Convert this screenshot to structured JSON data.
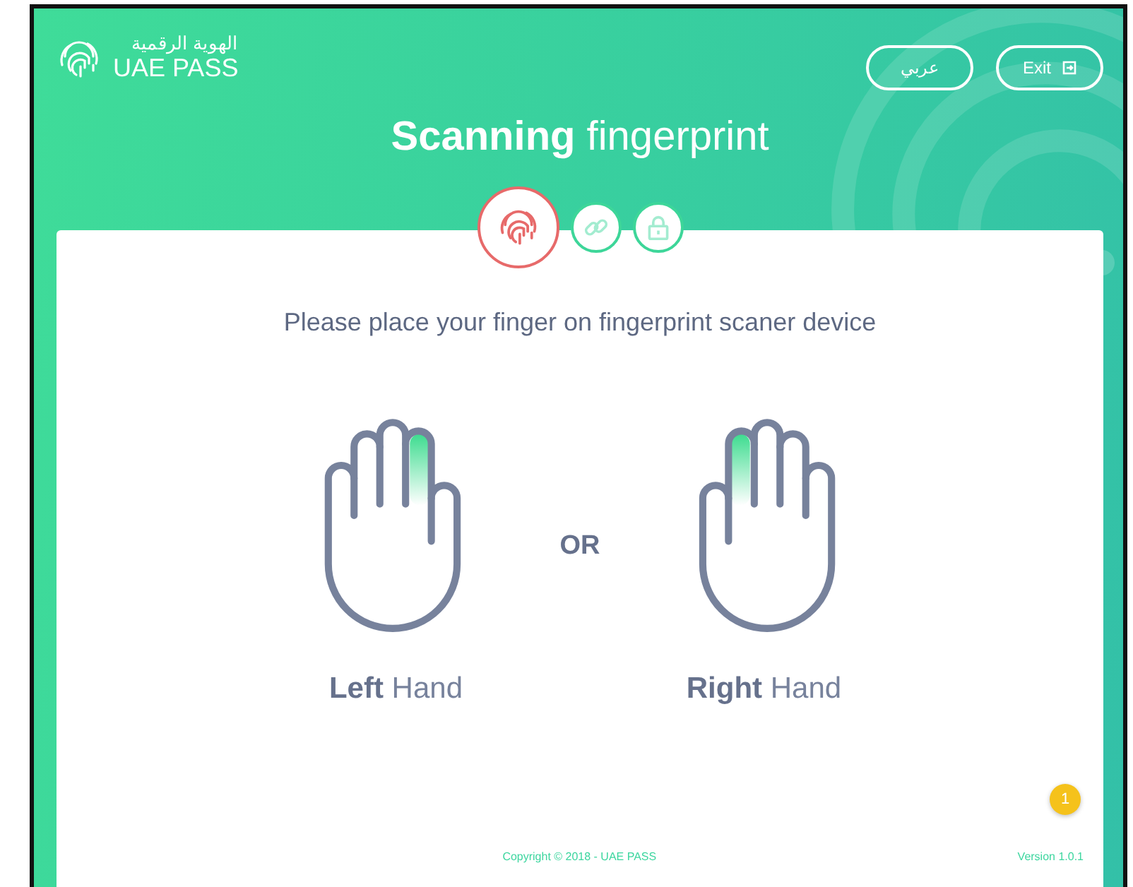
{
  "header": {
    "logo_arabic": "الهوية الرقمية",
    "logo_text": "UAE PASS",
    "buttons": [
      {
        "label": "عربي",
        "kind": "language"
      },
      {
        "label": "Exit",
        "kind": "exit"
      }
    ]
  },
  "title": "**Scanning** fingerprint",
  "steps": [
    {
      "kind": "fingerprint",
      "selected": true
    },
    {
      "kind": "link",
      "selected": false
    },
    {
      "kind": "lock",
      "selected": false
    }
  ],
  "instruction": "Please place your finger on fingerprint scaner device",
  "hands": [
    {
      "kind": "left",
      "label": "**Left** Hand"
    },
    {
      "kind": "right",
      "label": "**Right** Hand"
    }
  ],
  "separator": "OR",
  "notification_badge": "1",
  "footer": {
    "copyright": "Copyright © 2018 - UAE PASS",
    "version": "Version 1.0.1"
  }
}
